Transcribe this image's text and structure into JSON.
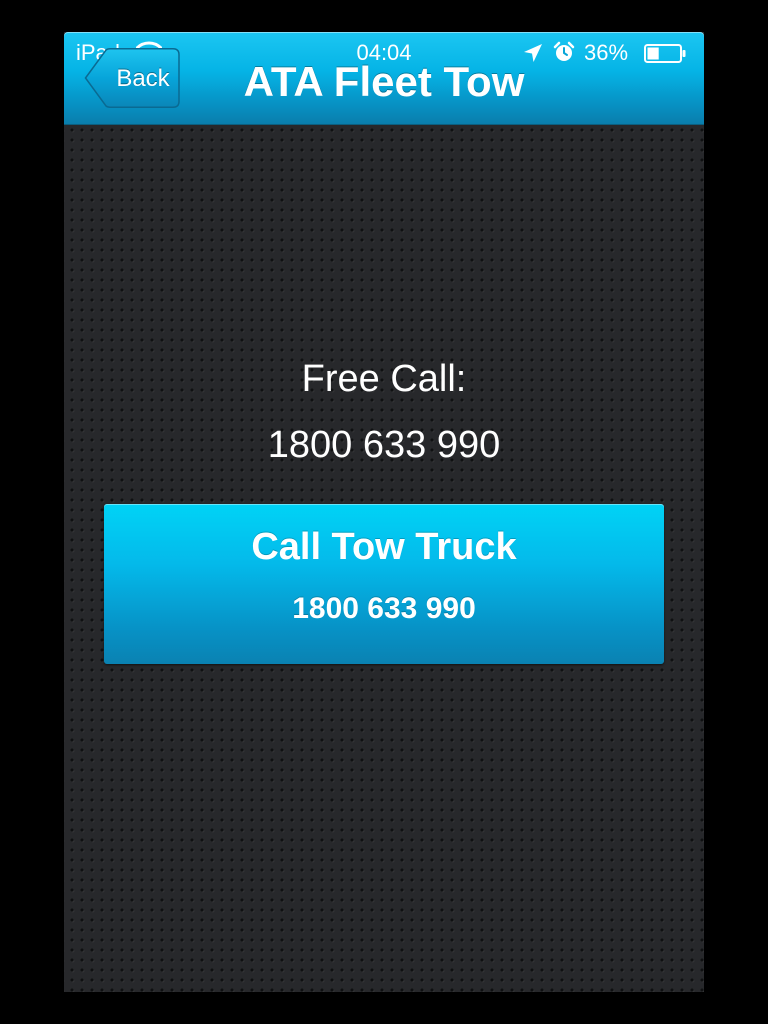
{
  "status_bar": {
    "carrier": "iPad",
    "time": "04:04",
    "battery_percent": "36%",
    "battery_level": 0.36,
    "icons": [
      "wifi-icon",
      "location-arrow-icon",
      "alarm-clock-icon",
      "battery-icon"
    ]
  },
  "nav": {
    "back_label": "Back",
    "title": "ATA Fleet Tow"
  },
  "main": {
    "free_call_label": "Free Call:",
    "free_call_number": "1800 633 990",
    "call_button": {
      "title": "Call Tow Truck",
      "number": "1800 633 990"
    }
  },
  "colors": {
    "accent": "#05b4e6",
    "accent_dark": "#0a7eac",
    "background": "#27282b",
    "text": "#ffffff"
  }
}
